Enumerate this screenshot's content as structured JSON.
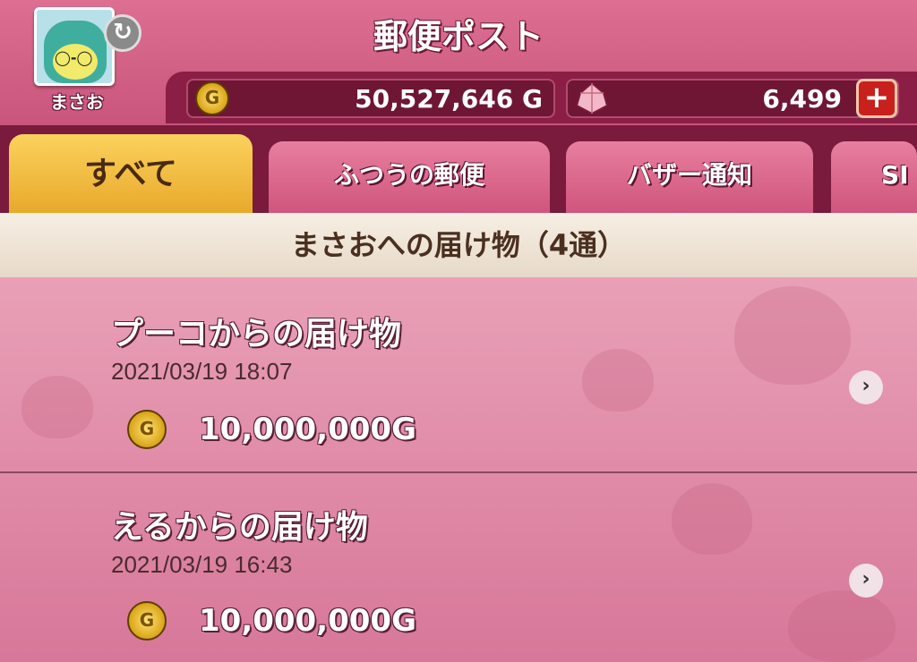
{
  "header": {
    "title": "郵便ポスト",
    "user_name": "まさお",
    "gold": "50,527,646 G",
    "gems": "6,499",
    "coin_letter": "G",
    "plus": "+"
  },
  "tabs": [
    {
      "label": "すべて"
    },
    {
      "label": "ふつうの郵便"
    },
    {
      "label": "バザー通知"
    },
    {
      "label": "SI"
    }
  ],
  "subheader": "まさおへの届け物（4通）",
  "mail_items": [
    {
      "title": "プーコからの届け物",
      "date": "2021/03/19  18:07",
      "amount": "10,000,000G"
    },
    {
      "title": "えるからの届け物",
      "date": "2021/03/19  16:43",
      "amount": "10,000,000G"
    }
  ],
  "colors": {
    "accent_pink": "#c9587d",
    "dark_maroon": "#7a1a3c",
    "active_tab": "#fbd25d"
  },
  "icons": [
    "refresh-icon",
    "gold-coin-icon",
    "gem-icon",
    "plus-icon",
    "chevron-right-icon"
  ]
}
